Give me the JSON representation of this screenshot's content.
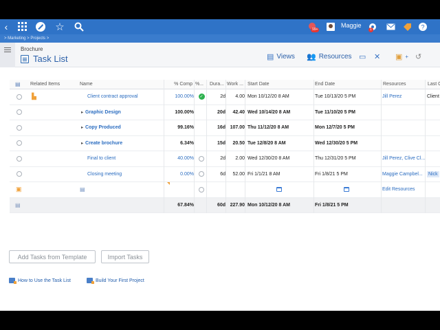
{
  "topbar": {
    "user_name": "Maggie",
    "notif_badge": "99+",
    "alert_badge": "1"
  },
  "breadcrumb": "> Marketing > Projects >",
  "header": {
    "subtitle": "Brochure",
    "title": "Task List",
    "views_label": "Views",
    "resources_label": "Resources"
  },
  "table": {
    "columns": [
      "Related Items",
      "Name",
      "% Comp",
      "%...",
      "Dura...",
      "Work ...",
      "Start Date",
      "End Date",
      "Resources",
      "Last C"
    ],
    "rows": [
      {
        "name": "Client contract approval",
        "pct": "100.00%",
        "dur": "2d",
        "work": "4.00",
        "start": "Mon 10/12/20 8 AM",
        "end": "Tue 10/13/20 5 PM",
        "res": "Jill Perez",
        "last": "Client"
      },
      {
        "name": "Graphic Design",
        "pct": "100.00%",
        "dur": "20d",
        "work": "42.40",
        "start": "Wed 10/14/20 8 AM",
        "end": "Tue 11/10/20 5 PM",
        "res": "",
        "last": ""
      },
      {
        "name": "Copy Produced",
        "pct": "99.16%",
        "dur": "16d",
        "work": "107.00",
        "start": "Thu 11/12/20 8 AM",
        "end": "Mon 12/7/20 5 PM",
        "res": "",
        "last": ""
      },
      {
        "name": "Create brochure",
        "pct": "6.34%",
        "dur": "15d",
        "work": "20.50",
        "start": "Tue 12/8/20 8 AM",
        "end": "Wed 12/30/20 5 PM",
        "res": "",
        "last": ""
      },
      {
        "name": "Final to client",
        "pct": "40.00%",
        "dur": "2d",
        "work": "2.00",
        "start": "Wed 12/30/20 8 AM",
        "end": "Thu 12/31/20 5 PM",
        "res": "Jill Perez, Clive Cl...",
        "last": ""
      },
      {
        "name": "Closing meeting",
        "pct": "0.00%",
        "dur": "6d",
        "work": "52.00",
        "start": "Fri 1/1/21 8 AM",
        "end": "Fri 1/8/21 5 PM",
        "res": "Maggie Campbel...",
        "last": "Nick"
      }
    ],
    "new_row": {
      "res": "Edit Resources"
    },
    "totals": {
      "pct": "67.84%",
      "dur": "60d",
      "work": "227.90",
      "start": "Mon 10/12/20 8 AM",
      "end": "Fri 1/8/21 5 PM"
    }
  },
  "actions": {
    "add_from_template": "Add Tasks from Template",
    "import_tasks": "Import Tasks"
  },
  "help_links": {
    "how_to": "How to Use the Task List",
    "build": "Build Your First Project"
  },
  "colors": {
    "topbar": "#2f73c7",
    "link": "#2a6cc0",
    "done": "#2eb14f"
  }
}
